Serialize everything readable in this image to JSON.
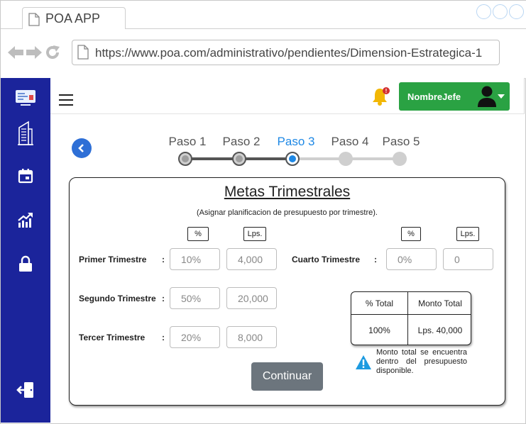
{
  "browser": {
    "tab_title": "POA APP",
    "url": "https://www.poa.com/administrativo/pendientes/Dimension-Estrategica-1"
  },
  "sidebar": {
    "items": [
      {
        "icon": "dashboard-icon"
      },
      {
        "icon": "building-icon"
      },
      {
        "icon": "calendar-icon"
      },
      {
        "icon": "chart-growth-icon"
      },
      {
        "icon": "lock-icon"
      },
      {
        "icon": "logout-icon"
      }
    ]
  },
  "topbar": {
    "user_name": "NombreJefe",
    "notification_badge": "!"
  },
  "steps": [
    {
      "label": "Paso 1",
      "state": "done"
    },
    {
      "label": "Paso 2",
      "state": "done"
    },
    {
      "label": "Paso 3",
      "state": "active"
    },
    {
      "label": "Paso 4",
      "state": "pending"
    },
    {
      "label": "Paso 5",
      "state": "pending"
    }
  ],
  "card": {
    "title": "Metas Trimestrales",
    "subtitle": "(Asignar planificacion de presupuesto por trimestre).",
    "col_pct": "%",
    "col_lps": "Lps.",
    "quarters": [
      {
        "label": "Primer Trimestre",
        "pct": "10%",
        "lps": "4,000"
      },
      {
        "label": "Segundo Trimestre",
        "pct": "50%",
        "lps": "20,000"
      },
      {
        "label": "Tercer Trimestre",
        "pct": "20%",
        "lps": "8,000"
      },
      {
        "label": "Cuarto Trimestre",
        "pct": "0%",
        "lps": "0"
      }
    ],
    "colon": ":",
    "summary": {
      "header_pct": "% Total",
      "header_amount": "Monto Total",
      "value_pct": "100%",
      "value_amount": "Lps. 40,000"
    },
    "warning": "Monto total se encuentra dentro del presupuesto disponible.",
    "continue_label": "Continuar"
  },
  "colors": {
    "sidebar": "#1b249b",
    "user_button": "#2aa243",
    "active_step": "#1e88e5",
    "continue_button": "#6c757d",
    "warning": "#1e9be0"
  }
}
